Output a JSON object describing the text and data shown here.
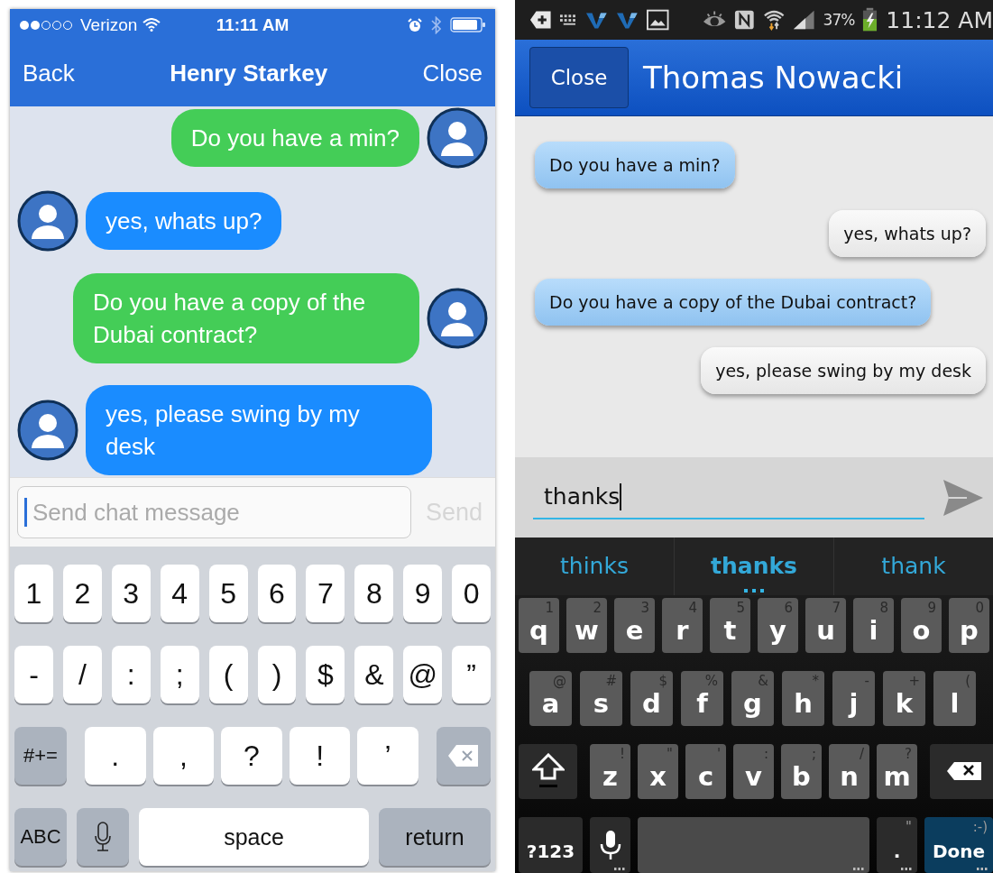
{
  "ios": {
    "status_bar": {
      "carrier": "Verizon",
      "time": "11:11 AM"
    },
    "nav": {
      "back": "Back",
      "title": "Henry Starkey",
      "close": "Close"
    },
    "messages": [
      {
        "outgoing": true,
        "text": "Do you have a min?"
      },
      {
        "outgoing": false,
        "text": "yes, whats up?"
      },
      {
        "outgoing": true,
        "text": "Do you have a copy of the Dubai contract?"
      },
      {
        "outgoing": false,
        "text": "yes, please swing by my desk"
      }
    ],
    "composer": {
      "placeholder": "Send chat message",
      "send": "Send",
      "send_disabled": true
    },
    "keyboard": [
      [
        {
          "kind": "char",
          "label": "1"
        },
        {
          "kind": "char",
          "label": "2"
        },
        {
          "kind": "char",
          "label": "3"
        },
        {
          "kind": "char",
          "label": "4"
        },
        {
          "kind": "char",
          "label": "5"
        },
        {
          "kind": "char",
          "label": "6"
        },
        {
          "kind": "char",
          "label": "7"
        },
        {
          "kind": "char",
          "label": "8"
        },
        {
          "kind": "char",
          "label": "9"
        },
        {
          "kind": "char",
          "label": "0"
        }
      ],
      [
        {
          "kind": "char",
          "label": "-"
        },
        {
          "kind": "char",
          "label": "/"
        },
        {
          "kind": "char",
          "label": ":"
        },
        {
          "kind": "char",
          "label": ";"
        },
        {
          "kind": "char",
          "label": "("
        },
        {
          "kind": "char",
          "label": ")"
        },
        {
          "kind": "char",
          "label": "$"
        },
        {
          "kind": "char",
          "label": "&"
        },
        {
          "kind": "char",
          "label": "@"
        },
        {
          "kind": "char",
          "label": "”"
        }
      ],
      [
        {
          "kind": "function",
          "label": "#+="
        },
        {
          "kind": "char",
          "label": "."
        },
        {
          "kind": "char",
          "label": ","
        },
        {
          "kind": "char",
          "label": "?"
        },
        {
          "kind": "char",
          "label": "!"
        },
        {
          "kind": "char",
          "label": "’"
        },
        {
          "kind": "delete"
        }
      ],
      [
        {
          "kind": "function",
          "label": "ABC"
        },
        {
          "kind": "mic"
        },
        {
          "kind": "space",
          "label": "space"
        },
        {
          "kind": "action",
          "label": "return"
        }
      ]
    ]
  },
  "android": {
    "status_bar": {
      "battery": "37%",
      "time": "11:12 AM"
    },
    "header": {
      "close": "Close",
      "title": "Thomas Nowacki"
    },
    "messages": [
      {
        "outgoing": false,
        "text": "Do you have a min?"
      },
      {
        "outgoing": true,
        "text": "yes, whats up?"
      },
      {
        "outgoing": false,
        "text": "Do you have a copy of the Dubai contract?"
      },
      {
        "outgoing": true,
        "text": "yes, please swing by my desk"
      }
    ],
    "composer": {
      "value": "thanks"
    },
    "suggestions": [
      {
        "text": "thinks",
        "selected": false
      },
      {
        "text": "thanks",
        "selected": true
      },
      {
        "text": "thank",
        "selected": false
      }
    ],
    "keyboard": [
      [
        {
          "kind": "char",
          "label": "q",
          "hint": "1"
        },
        {
          "kind": "char",
          "label": "w",
          "hint": "2"
        },
        {
          "kind": "char",
          "label": "e",
          "hint": "3"
        },
        {
          "kind": "char",
          "label": "r",
          "hint": "4"
        },
        {
          "kind": "char",
          "label": "t",
          "hint": "5"
        },
        {
          "kind": "char",
          "label": "y",
          "hint": "6"
        },
        {
          "kind": "char",
          "label": "u",
          "hint": "7"
        },
        {
          "kind": "char",
          "label": "i",
          "hint": "8"
        },
        {
          "kind": "char",
          "label": "o",
          "hint": "9"
        },
        {
          "kind": "char",
          "label": "p",
          "hint": "0"
        }
      ],
      [
        {
          "kind": "char",
          "label": "a",
          "hint": "@"
        },
        {
          "kind": "char",
          "label": "s",
          "hint": "#"
        },
        {
          "kind": "char",
          "label": "d",
          "hint": "$"
        },
        {
          "kind": "char",
          "label": "f",
          "hint": "%"
        },
        {
          "kind": "char",
          "label": "g",
          "hint": "&"
        },
        {
          "kind": "char",
          "label": "h",
          "hint": "*"
        },
        {
          "kind": "char",
          "label": "j",
          "hint": "-"
        },
        {
          "kind": "char",
          "label": "k",
          "hint": "+"
        },
        {
          "kind": "char",
          "label": "l",
          "hint": "("
        }
      ],
      [
        {
          "kind": "shift"
        },
        {
          "kind": "char",
          "label": "z",
          "hint": "!"
        },
        {
          "kind": "char",
          "label": "x",
          "hint": "\""
        },
        {
          "kind": "char",
          "label": "c",
          "hint": "'"
        },
        {
          "kind": "char",
          "label": "v",
          "hint": ":"
        },
        {
          "kind": "char",
          "label": "b",
          "hint": ";"
        },
        {
          "kind": "char",
          "label": "n",
          "hint": "/"
        },
        {
          "kind": "char",
          "label": "m",
          "hint": "?"
        },
        {
          "kind": "delete"
        }
      ],
      [
        {
          "kind": "function",
          "label": "?123"
        },
        {
          "kind": "mic",
          "long_press": true
        },
        {
          "kind": "space",
          "long_press": true
        },
        {
          "kind": "function",
          "label": ".",
          "hint": "\"",
          "long_press": true
        },
        {
          "kind": "action",
          "label": "Done",
          "hint": ":-)",
          "long_press": true
        }
      ]
    ]
  }
}
